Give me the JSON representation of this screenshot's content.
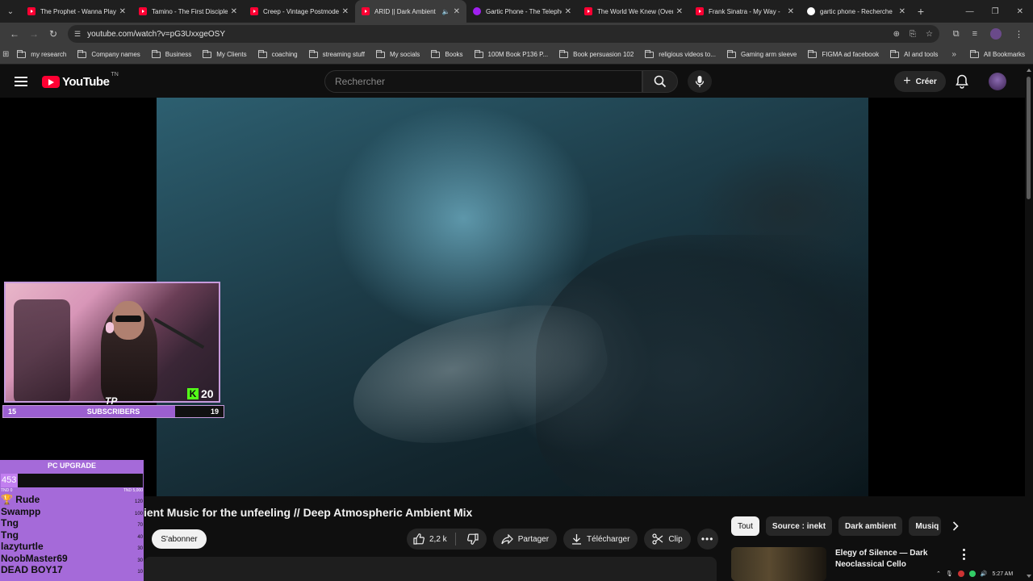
{
  "browser": {
    "tabs": [
      {
        "title": "The Prophet - Wanna Play",
        "icon": "youtube-icon"
      },
      {
        "title": "Tamino - The First Disciple",
        "icon": "youtube-icon"
      },
      {
        "title": "Creep - Vintage Postmodern",
        "icon": "youtube-icon"
      },
      {
        "title": "ARID || Dark Ambient",
        "icon": "youtube-icon",
        "active": true
      },
      {
        "title": "Gartic Phone - The Telephone",
        "icon": "gartic-icon"
      },
      {
        "title": "The World We Knew (Over",
        "icon": "youtube-icon"
      },
      {
        "title": "Frank Sinatra - My Way -",
        "icon": "youtube-icon"
      },
      {
        "title": "gartic phone - Recherche",
        "icon": "google-icon"
      }
    ],
    "url": "youtube.com/watch?v=pG3UxxgeOSY",
    "bookmarks": [
      "my research",
      "Company names",
      "Business",
      "My Clients",
      "coaching",
      "streaming stuff",
      "My socials",
      "Books",
      "100M Book P136 P...",
      "Book persuasion 102",
      "religious videos to...",
      "Gaming arm sleeve",
      "FIGMA ad facebook",
      "AI and tools"
    ],
    "all_bookmarks": "All Bookmarks"
  },
  "youtube": {
    "logo_text": "YouTube",
    "logo_country": "TN",
    "search_placeholder": "Rechercher",
    "create_label": "Créer",
    "video_title": "ient Music for the unfeeling // Deep Atmospheric Ambient Mix",
    "subscribe_label": "S'abonner",
    "likes": "2,2 k",
    "share_label": "Partager",
    "download_label": "Télécharger",
    "clip_label": "Clip",
    "chips": [
      "Tout",
      "Source : inekt",
      "Dark ambient",
      "Musiq"
    ],
    "recommendation_title": "Elegy of Silence — Dark Neoclassical Cello"
  },
  "overlay": {
    "kick_count": "20",
    "kick_letter": "K",
    "tp_mark": "TP",
    "subs_current": "15",
    "subs_label": "SUBSCRIBERS",
    "subs_goal": "19",
    "subs_fraction": 0.78,
    "pc_title": "PC UPGRADE",
    "pc_amount": "453",
    "pc_min": "TND 0",
    "pc_max": "TND 5,000",
    "pc_fraction": 0.12,
    "donors": [
      {
        "name": "🏆 Rude",
        "amount": "120"
      },
      {
        "name": "Swampp",
        "amount": "100"
      },
      {
        "name": "Tng",
        "amount": "70"
      },
      {
        "name": "Tng",
        "amount": "40"
      },
      {
        "name": "lazyturtle",
        "amount": "30"
      },
      {
        "name": "NoobMaster69",
        "amount": "30"
      },
      {
        "name": "DEAD BOY17",
        "amount": "10"
      }
    ]
  },
  "system": {
    "time": "5:27 AM"
  }
}
